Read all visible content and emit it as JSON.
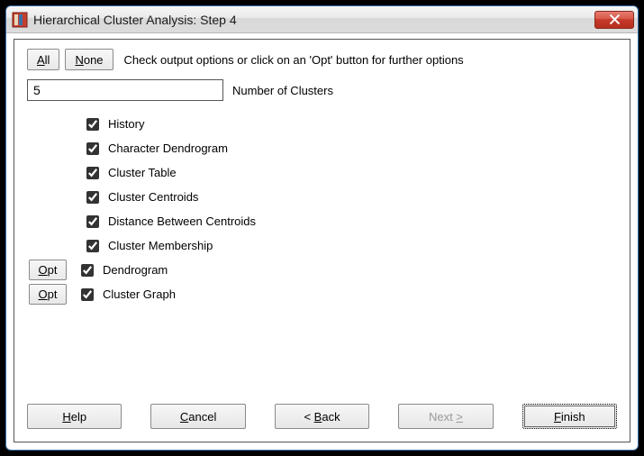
{
  "window": {
    "title": "Hierarchical Cluster Analysis: Step 4"
  },
  "toolbar": {
    "all_label": "All",
    "all_underline": "A",
    "none_label": "None",
    "none_underline": "N",
    "instruction": "Check output options or click on an 'Opt' button for further options"
  },
  "clusters": {
    "value": "5",
    "label": "Number of Clusters"
  },
  "opt_label": "Opt",
  "options": [
    {
      "has_opt": false,
      "checked": true,
      "label": "History"
    },
    {
      "has_opt": false,
      "checked": true,
      "label": "Character Dendrogram"
    },
    {
      "has_opt": false,
      "checked": true,
      "label": "Cluster Table"
    },
    {
      "has_opt": false,
      "checked": true,
      "label": "Cluster Centroids"
    },
    {
      "has_opt": false,
      "checked": true,
      "label": "Distance Between Centroids"
    },
    {
      "has_opt": false,
      "checked": true,
      "label": "Cluster Membership"
    },
    {
      "has_opt": true,
      "checked": true,
      "label": "Dendrogram"
    },
    {
      "has_opt": true,
      "checked": true,
      "label": "Cluster Graph"
    }
  ],
  "footer": {
    "help": {
      "text": "Help",
      "u": "H"
    },
    "cancel": {
      "text": "Cancel",
      "u": "C"
    },
    "back": {
      "prefix": "< ",
      "text": "Back",
      "u": "B"
    },
    "next": {
      "text": "Next ",
      "suffix": ">",
      "u": ">",
      "disabled": true
    },
    "finish": {
      "text": "Finish",
      "u": "F",
      "default": true
    }
  }
}
